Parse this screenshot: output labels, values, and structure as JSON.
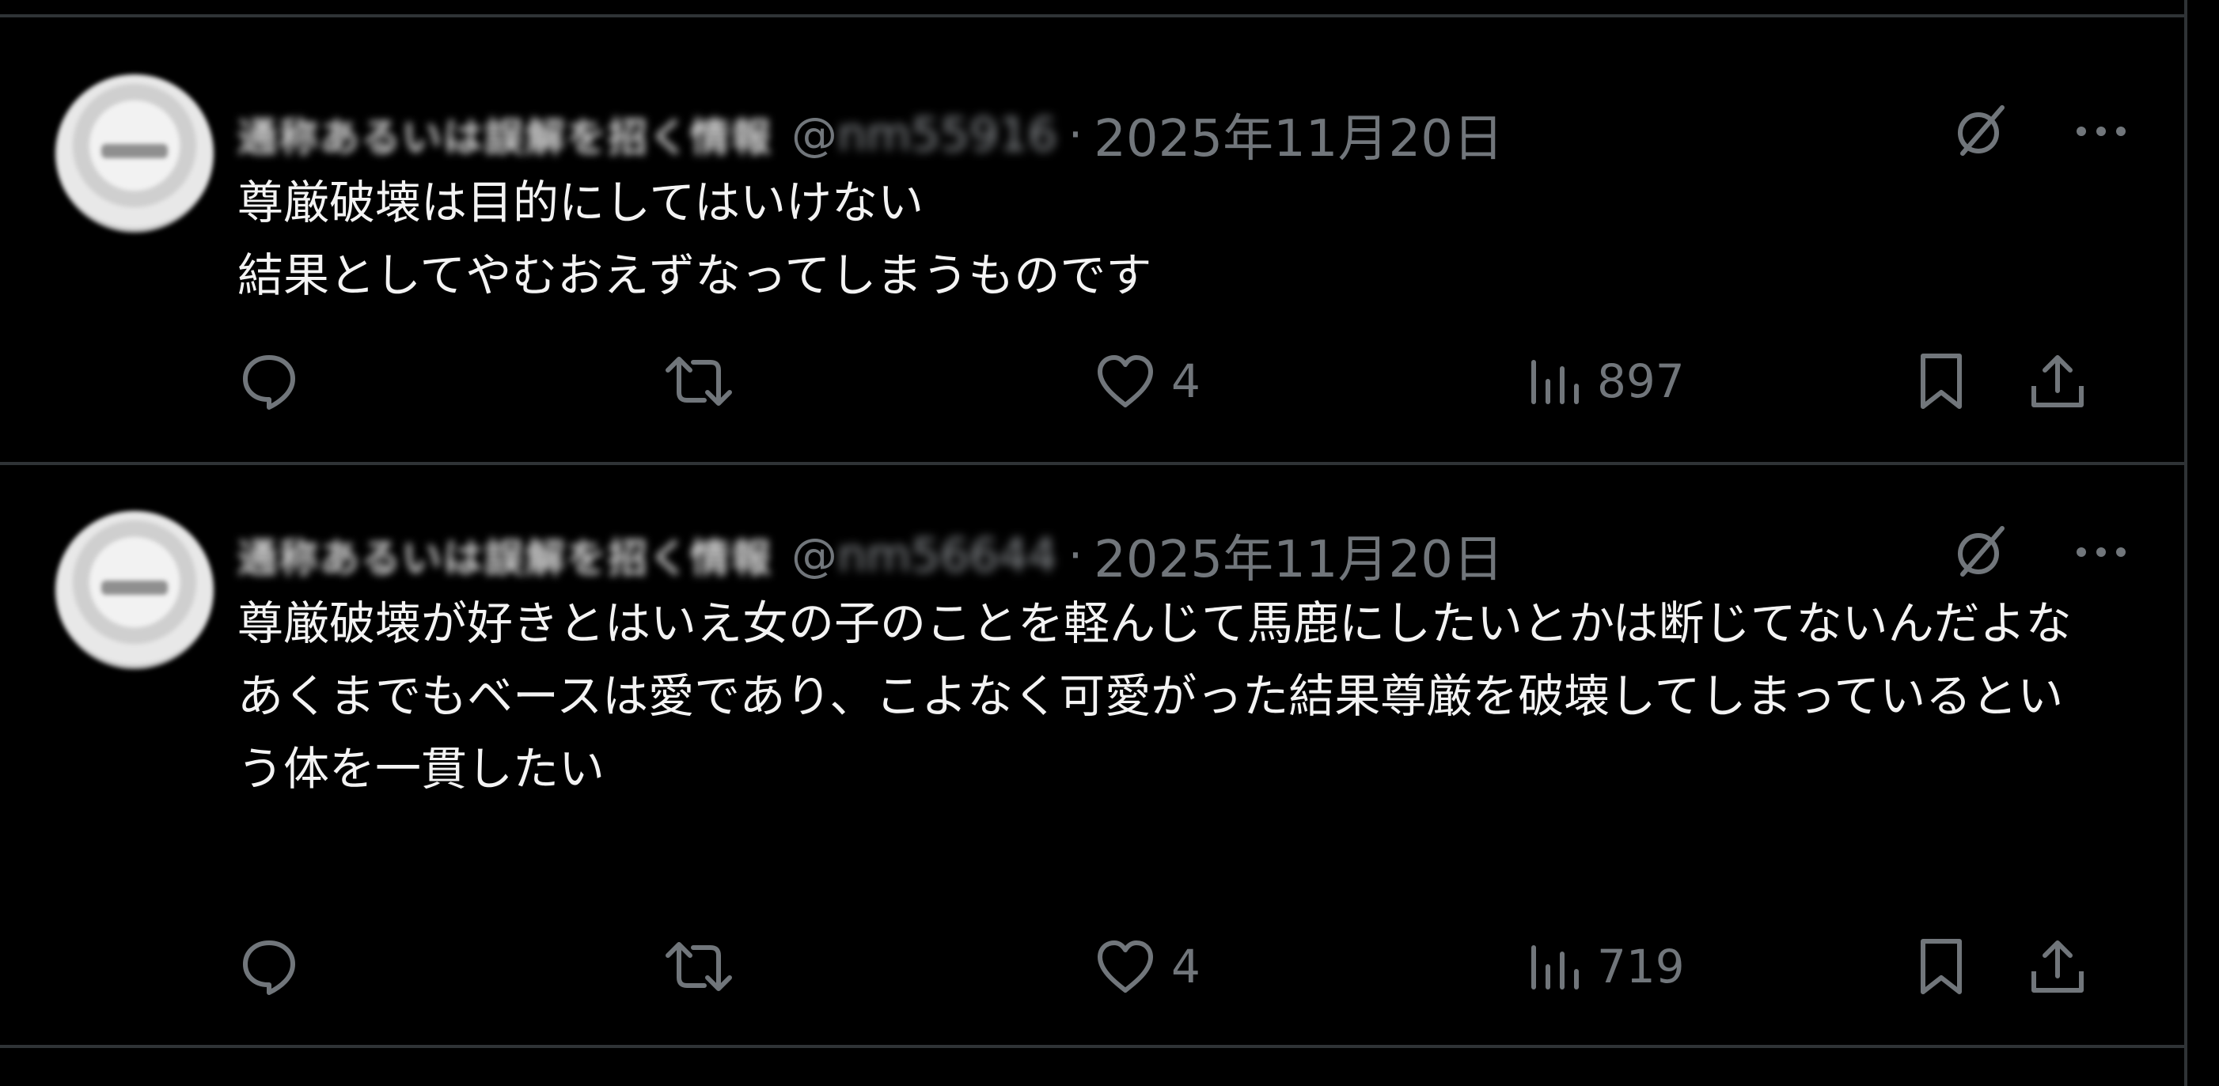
{
  "tweets": [
    {
      "display_name": "通称あるいは誤解を招く情報",
      "handle_prefix": "@",
      "handle_blurred": "nm55916",
      "dot": "·",
      "timestamp": "2025年11月20日",
      "text": "尊厳破壊は目的にしてはいけない\n結果としてやむおえずなってしまうものです",
      "likes": "4",
      "views": "897"
    },
    {
      "display_name": "通称あるいは誤解を招く情報",
      "handle_prefix": "@",
      "handle_blurred": "nm56644",
      "dot": "·",
      "timestamp": "2025年11月20日",
      "text": "尊厳破壊が好きとはいえ女の子のことを軽んじて馬鹿にしたいとかは断じてないんだよな\nあくまでもベースは愛であり、こよなく可愛がった結果尊厳を破壊してしまっているという体を一貫したい",
      "likes": "4",
      "views": "719"
    }
  ],
  "colors": {
    "background": "#000000",
    "divider": "#2f3336",
    "muted": "#71767b",
    "text": "#e7e9ea"
  },
  "icons": {
    "reply": "reply-icon",
    "retweet": "retweet-icon",
    "like": "heart-icon",
    "views": "views-icon",
    "bookmark": "bookmark-icon",
    "share": "share-icon",
    "grok": "grok-icon",
    "more": "more-icon"
  }
}
